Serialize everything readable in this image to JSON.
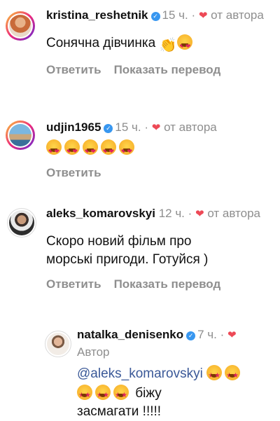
{
  "comments": [
    {
      "username": "kristina_reshetnik",
      "time": "15 ч.",
      "liked_by": "от автора",
      "text": "Сонячна дівчинка",
      "reply_label": "Ответить",
      "translate_label": "Показать перевод"
    },
    {
      "username": "udjin1965",
      "time": "15 ч.",
      "liked_by": "от автора",
      "reply_label": "Ответить"
    },
    {
      "username": "aleks_komarovskyi",
      "time": "12 ч.",
      "liked_by": "от автора",
      "text_line1": "Скоро новий фільм про",
      "text_line2": "морські пригоди. Готуйся )",
      "reply_label": "Ответить",
      "translate_label": "Показать перевод"
    },
    {
      "username": "natalka_denisenko",
      "time": "7 ч.",
      "badge": "Автор",
      "mention": "@aleks_komarovskyi",
      "text_after": "біжу",
      "text_line3": "засмагати !!!!!"
    }
  ],
  "colors": {
    "verified": "#3897f0",
    "heart": "#ed4956",
    "mention": "#3b5998",
    "meta": "#8e8e8e"
  }
}
